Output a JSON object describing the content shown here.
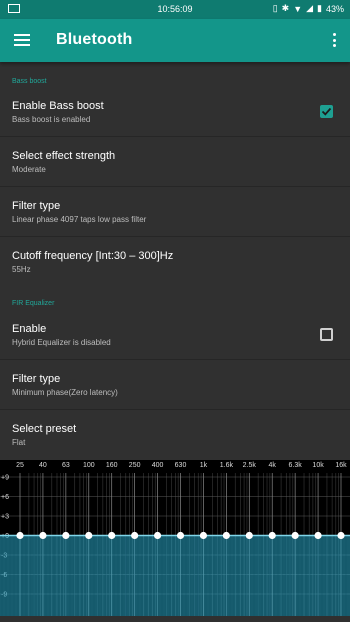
{
  "status_bar": {
    "time": "10:56:09",
    "battery": "43%"
  },
  "app_bar": {
    "title": "Bluetooth"
  },
  "sections": {
    "bass_boost_header": "Bass boost",
    "fir_equalizer_header": "FIR Equalizer"
  },
  "prefs": {
    "enable_bass_boost": {
      "title": "Enable Bass boost",
      "summary": "Bass boost is enabled",
      "checked": true
    },
    "effect_strength": {
      "title": "Select effect strength",
      "summary": "Moderate"
    },
    "filter_type_bass": {
      "title": "Filter type",
      "summary": "Linear phase 4097 taps low pass filter"
    },
    "cutoff_frequency": {
      "title": "Cutoff frequency [Int:30 – 300]Hz",
      "summary": "55Hz"
    },
    "enable_eq": {
      "title": "Enable",
      "summary": "Hybrid Equalizer is disabled",
      "checked": false
    },
    "filter_type_eq": {
      "title": "Filter type",
      "summary": "Minimum phase(Zero latency)"
    },
    "select_preset": {
      "title": "Select preset",
      "summary": "Flat"
    }
  },
  "equalizer": {
    "bands": [
      "25",
      "40",
      "63",
      "100",
      "160",
      "250",
      "400",
      "630",
      "1k",
      "1.6k",
      "2.5k",
      "4k",
      "6.3k",
      "10k",
      "16k"
    ],
    "gains_db": [
      0,
      0,
      0,
      0,
      0,
      0,
      0,
      0,
      0,
      0,
      0,
      0,
      0,
      0,
      0
    ],
    "db_labels": [
      "+9",
      "+6",
      "+3",
      "+0",
      "-3",
      "-6",
      "-9"
    ],
    "accent_color": "#2aa8c9"
  }
}
